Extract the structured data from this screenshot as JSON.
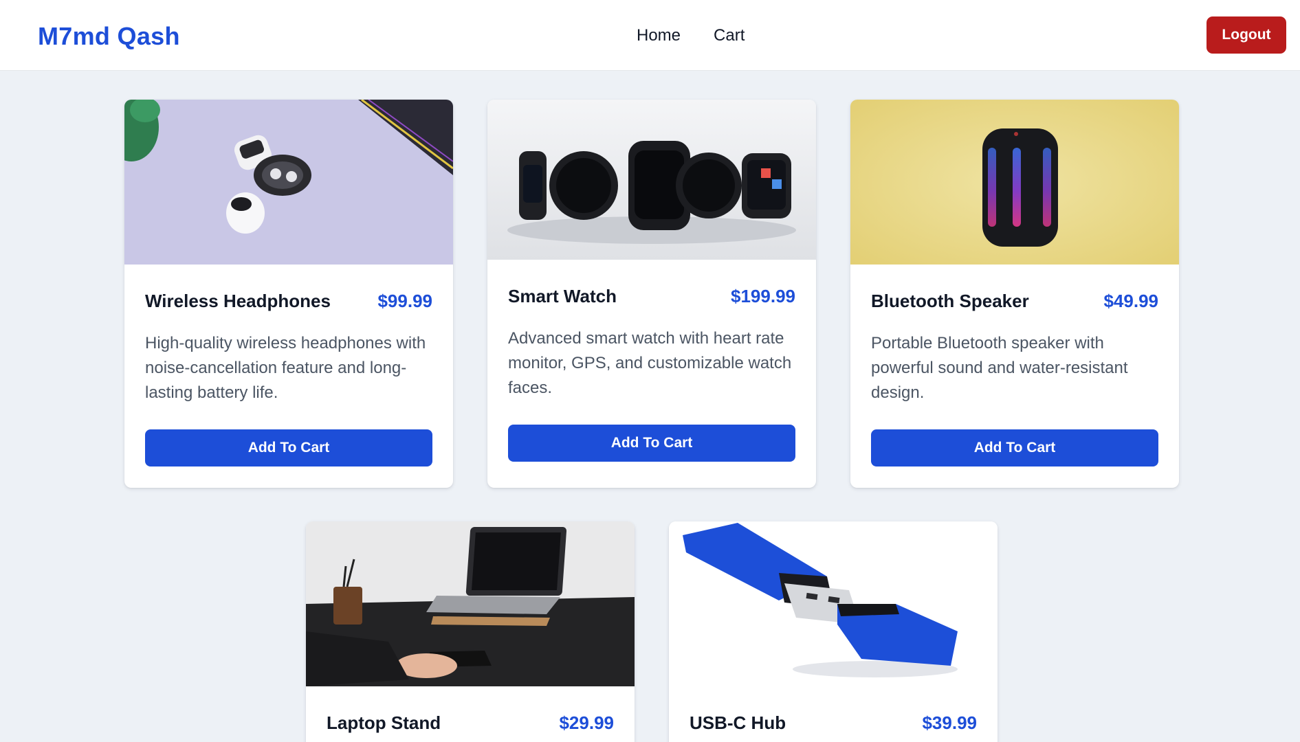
{
  "brand": "M7md Qash",
  "nav": {
    "home": "Home",
    "cart": "Cart"
  },
  "logout_label": "Logout",
  "add_to_cart_label": "Add To Cart",
  "colors": {
    "brand": "#1d4ed8",
    "logout": "#b91c1c",
    "price": "#1d4ed8",
    "page_bg": "#edf1f6"
  },
  "products": [
    {
      "name": "Wireless Headphones",
      "price": "$99.99",
      "description": "High-quality wireless headphones with noise-cancellation feature and long-lasting battery life.",
      "image": "earbuds-photo"
    },
    {
      "name": "Smart Watch",
      "price": "$199.99",
      "description": "Advanced smart watch with heart rate monitor, GPS, and customizable watch faces.",
      "image": "smartwatch-photo"
    },
    {
      "name": "Bluetooth Speaker",
      "price": "$49.99",
      "description": "Portable Bluetooth speaker with powerful sound and water-resistant design.",
      "image": "speaker-photo"
    },
    {
      "name": "Laptop Stand",
      "price": "$29.99",
      "description": "",
      "image": "laptop-photo"
    },
    {
      "name": "USB-C Hub",
      "price": "$39.99",
      "description": "",
      "image": "usb-drive-photo"
    }
  ]
}
